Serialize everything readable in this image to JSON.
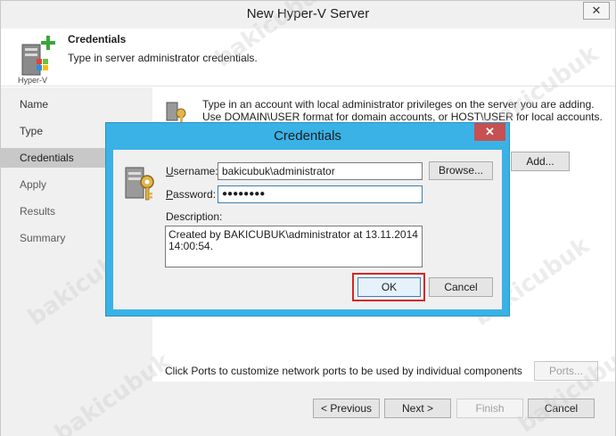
{
  "window": {
    "title": "New Hyper-V Server",
    "close_glyph": "✕"
  },
  "header": {
    "icon_label": "Hyper-V",
    "title": "Credentials",
    "subtitle": "Type in server administrator credentials."
  },
  "sidebar": {
    "items": [
      {
        "label": "Name"
      },
      {
        "label": "Type"
      },
      {
        "label": "Credentials",
        "current": true
      },
      {
        "label": "Apply"
      },
      {
        "label": "Results"
      },
      {
        "label": "Summary"
      }
    ]
  },
  "main": {
    "info_line1": "Type in an account with local administrator privileges on the server you are adding.",
    "info_line2": "Use DOMAIN\\USER format for domain accounts, or HOST\\USER for local accounts.",
    "add_label": "Add...",
    "ports_text": "Click Ports to customize network ports to be used by individual components",
    "ports_label": "Ports..."
  },
  "footer": {
    "previous_label": "< Previous",
    "next_label": "Next >",
    "finish_label": "Finish",
    "cancel_label": "Cancel"
  },
  "dialog": {
    "title": "Credentials",
    "close_glyph": "✕",
    "username_label_u": "U",
    "username_label_rest": "sername:",
    "username_value": "bakicubuk\\administrator",
    "password_label_u": "P",
    "password_label_rest": "assword:",
    "password_value": "●●●●●●●●",
    "browse_label": "Browse...",
    "description_label": "Description:",
    "description_value": "Created by BAKICUBUK\\administrator at 13.11.2014\n14:00:54.",
    "ok_label": "OK",
    "cancel_label": "Cancel"
  },
  "watermark": "bakicubuk",
  "colors": {
    "dialog_frame": "#3ab2e6",
    "close_red": "#c75050",
    "highlight_red": "#d42727",
    "sidebar_bg": "#f0f0f0",
    "sidebar_selected": "#c8c8c8"
  }
}
